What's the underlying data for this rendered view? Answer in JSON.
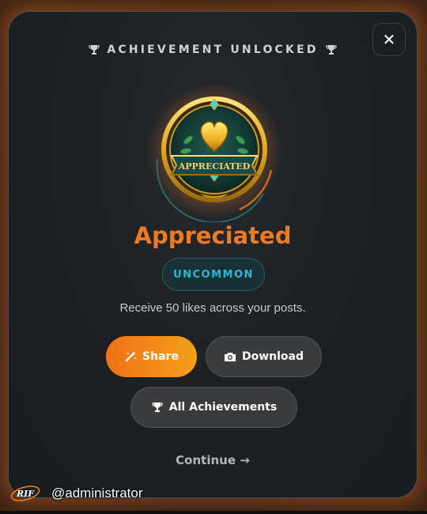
{
  "modal": {
    "header": "ACHIEVEMENT UNLOCKED",
    "close_label": "✕",
    "badge": {
      "ribbon_text": "APPRECIATED",
      "icon": "golden-heart-badge"
    },
    "title": "Appreciated",
    "rarity": "UNCOMMON",
    "description": "Receive 50 likes across your posts.",
    "buttons": {
      "share": "Share",
      "download": "Download",
      "all_achievements": "All Achievements"
    },
    "continue_label": "Continue →"
  },
  "footer": {
    "logo_text": "RIF",
    "username": "@administrator"
  },
  "colors": {
    "accent_orange": "#f07a22",
    "rarity_teal": "#2fb7cf",
    "panel": "#1e2124"
  }
}
